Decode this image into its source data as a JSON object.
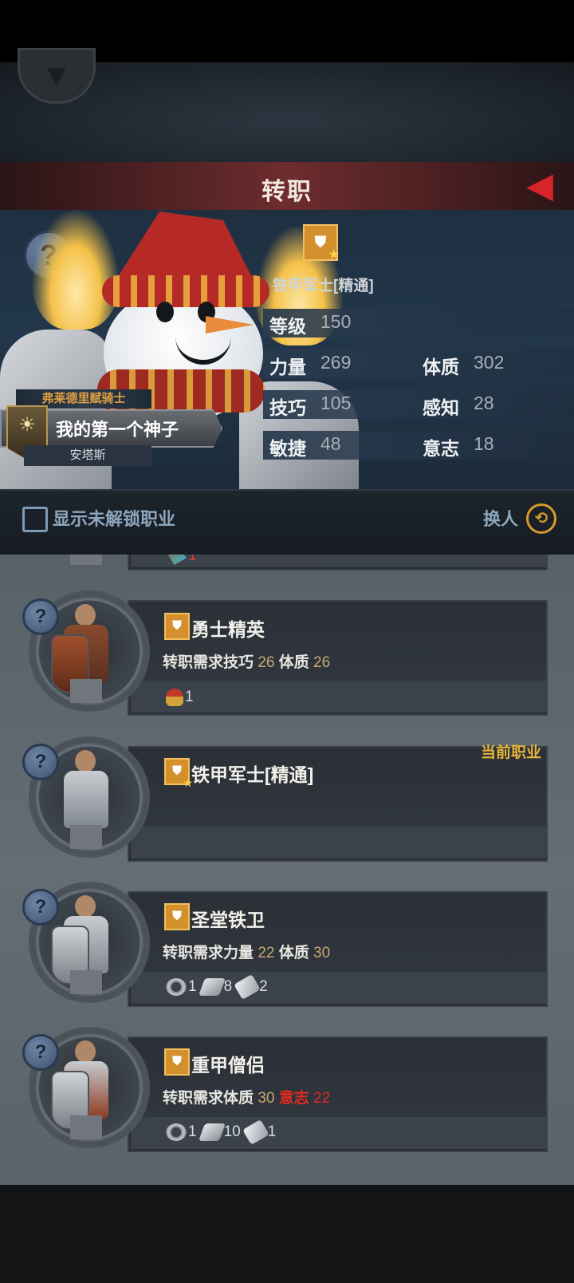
{
  "header": {
    "title": "转职",
    "back_icon": "back-arrow-icon",
    "down_icon": "chevron-down-icon"
  },
  "hero": {
    "title_class": "弗莱德里赋骑士",
    "name": "我的第一个神子",
    "subtitle": "安塔斯",
    "current_class": "铁甲军士[精通]",
    "stats": {
      "level_label": "等级",
      "level": "150",
      "str_label": "力量",
      "str": "269",
      "con_label": "体质",
      "con": "302",
      "skill_label": "技巧",
      "skill": "105",
      "per_label": "感知",
      "per": "28",
      "agi_label": "敏捷",
      "agi": "48",
      "will_label": "意志",
      "will": "18"
    }
  },
  "filter": {
    "show_locked_label": "显示未解锁职业",
    "swap_label": "换人",
    "swap_icon": "swap-icon"
  },
  "jobs": {
    "partial": {
      "mat1": "1"
    },
    "warrior_elite": {
      "name": "勇士精英",
      "req_prefix": "转职需求",
      "req_stat1": "技巧",
      "req_val1": "26",
      "req_stat2": "体质",
      "req_val2": "26",
      "mat1": "1"
    },
    "iron_soldier": {
      "name": "铁甲军士[精通]",
      "current_label": "当前职业"
    },
    "holy_guard": {
      "name": "圣堂铁卫",
      "req_prefix": "转职需求",
      "req_stat1": "力量",
      "req_val1": "22",
      "req_stat2": "体质",
      "req_val2": "30",
      "mat1": "1",
      "mat2": "8",
      "mat3": "2"
    },
    "heavy_cleric": {
      "name": "重甲僧侣",
      "req_prefix": "转职需求",
      "req_stat1": "体质",
      "req_val1": "30",
      "req_stat2": "意志",
      "req_val2": "22",
      "mat1": "1",
      "mat2": "10",
      "mat3": "1"
    }
  },
  "colors": {
    "accent_gold": "#e8b43a",
    "warning_red": "#e02a20",
    "title_bar": "#6e2c2e"
  }
}
